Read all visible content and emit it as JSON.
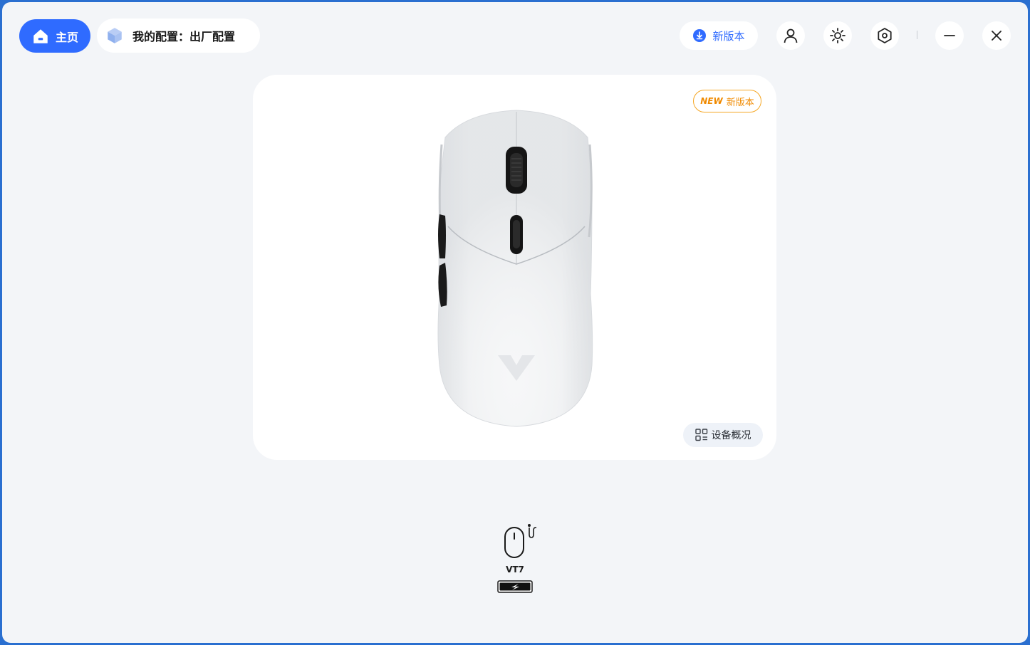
{
  "header": {
    "home_label": "主页",
    "config_label": "我的配置：出厂配置",
    "update_label": "新版本",
    "icons": [
      "home-icon",
      "cube-icon",
      "download-icon",
      "user-icon",
      "lighting-icon",
      "settings-icon",
      "minimize-icon",
      "close-icon"
    ]
  },
  "device_card": {
    "new_tag": "NEW",
    "new_label": "新版本",
    "overview_label": "设备概况"
  },
  "device": {
    "name": "VT7",
    "connection": "wired",
    "charging": true
  },
  "colors": {
    "accent": "#2f6bff",
    "badge": "#f5a623",
    "background": "#f3f5f8"
  }
}
